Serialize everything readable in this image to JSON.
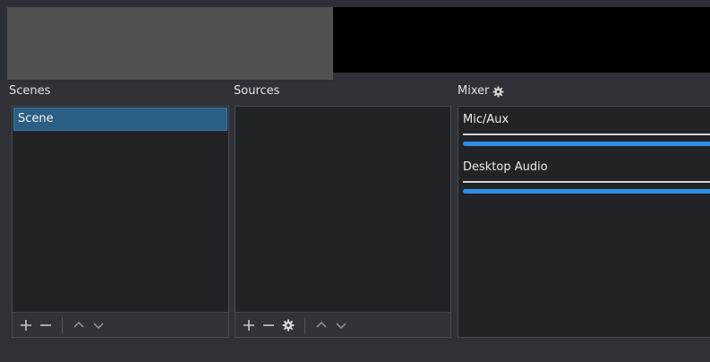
{
  "scenes": {
    "title": "Scenes",
    "items": [
      {
        "label": "Scene",
        "selected": true
      }
    ]
  },
  "sources": {
    "title": "Sources",
    "items": []
  },
  "mixer": {
    "title": "Mixer",
    "tracks": [
      {
        "name": "Mic/Aux",
        "level": 1.0
      },
      {
        "name": "Desktop Audio",
        "level": 1.0
      }
    ]
  },
  "icons": {
    "add": "plus-icon",
    "remove": "minus-icon",
    "settings": "gear-icon",
    "move_up": "chevron-up-icon",
    "move_down": "chevron-down-icon"
  },
  "colors": {
    "selection": "#2b5f83",
    "slider": "#2e8ee6",
    "panel_bg": "#222327",
    "window_bg": "#303136",
    "preview_bg": "#000000"
  }
}
